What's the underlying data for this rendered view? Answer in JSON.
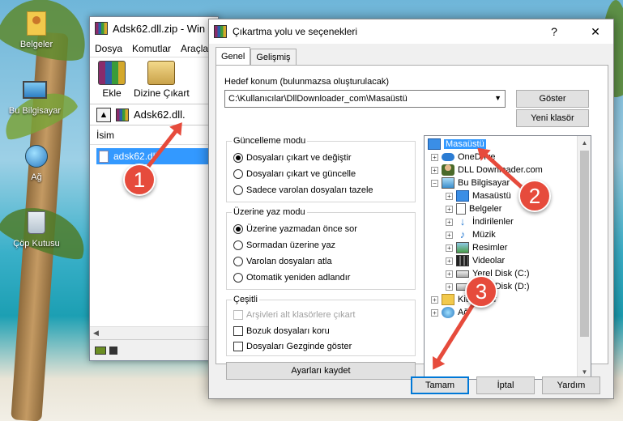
{
  "desktop": {
    "icons": [
      {
        "label": "Belgeler",
        "icon": "folder-icon"
      },
      {
        "label": "Bu Bilgisayar",
        "icon": "computer-icon"
      },
      {
        "label": "Ağ",
        "icon": "network-icon"
      },
      {
        "label": "Çöp Kutusu",
        "icon": "recycle-bin-icon"
      }
    ]
  },
  "winrar": {
    "title": "Adsk62.dll.zip - Win",
    "menu": [
      "Dosya",
      "Komutlar",
      "Araçla"
    ],
    "toolbar": {
      "add": "Ekle",
      "extract": "Dizine Çıkart"
    },
    "path": "Adsk62.dll.",
    "column_name": "İsim",
    "file": "adsk62.dll"
  },
  "dialog": {
    "title": "Çıkartma yolu ve seçenekleri",
    "help": "?",
    "close": "✕",
    "tabs": [
      "Genel",
      "Gelişmiş"
    ],
    "dest_label": "Hedef konum (bulunmazsa oluşturulacak)",
    "dest_value": "C:\\Kullanıcılar\\DllDownloader_com\\Masaüstü",
    "btn_show": "Göster",
    "btn_new_folder": "Yeni klasör",
    "update_mode": {
      "title": "Güncelleme modu",
      "options": [
        "Dosyaları çıkart ve değiştir",
        "Dosyaları çıkart ve güncelle",
        "Sadece varolan dosyaları tazele"
      ],
      "selected": 0
    },
    "overwrite_mode": {
      "title": "Üzerine yaz modu",
      "options": [
        "Üzerine yazmadan önce sor",
        "Sormadan üzerine yaz",
        "Varolan dosyaları atla",
        "Otomatik yeniden adlandır"
      ],
      "selected": 0
    },
    "misc": {
      "title": "Çeşitli",
      "options": [
        "Arşivleri alt klasörlere çıkart",
        "Bozuk dosyaları koru",
        "Dosyaları Gezginde göster"
      ]
    },
    "btn_save": "Ayarları kaydet",
    "tree": [
      {
        "label": "Masaüstü",
        "icon": "desktop-icon",
        "selected": true
      },
      {
        "label": "OneDrive",
        "icon": "cloud-icon"
      },
      {
        "label": "DLL Downloader.com",
        "icon": "user-icon"
      },
      {
        "label": "Bu Bilgisayar",
        "icon": "computer-icon"
      },
      {
        "label": "Masaüstü",
        "icon": "desktop-icon"
      },
      {
        "label": "Belgeler",
        "icon": "document-icon"
      },
      {
        "label": "İndirilenler",
        "icon": "download-icon"
      },
      {
        "label": "Müzik",
        "icon": "music-icon"
      },
      {
        "label": "Resimler",
        "icon": "pictures-icon"
      },
      {
        "label": "Videolar",
        "icon": "videos-icon"
      },
      {
        "label": "Yerel Disk (C:)",
        "icon": "drive-icon"
      },
      {
        "label": "Yerel Disk (D:)",
        "icon": "drive-icon"
      },
      {
        "label": "Kitaplıklar",
        "icon": "library-icon"
      },
      {
        "label": "Ağ",
        "icon": "network-icon"
      }
    ],
    "btn_ok": "Tamam",
    "btn_cancel": "İptal",
    "btn_help": "Yardım"
  },
  "markers": [
    "1",
    "2",
    "3"
  ],
  "colors": {
    "accent": "#3399ff",
    "marker": "#e64b3c"
  }
}
